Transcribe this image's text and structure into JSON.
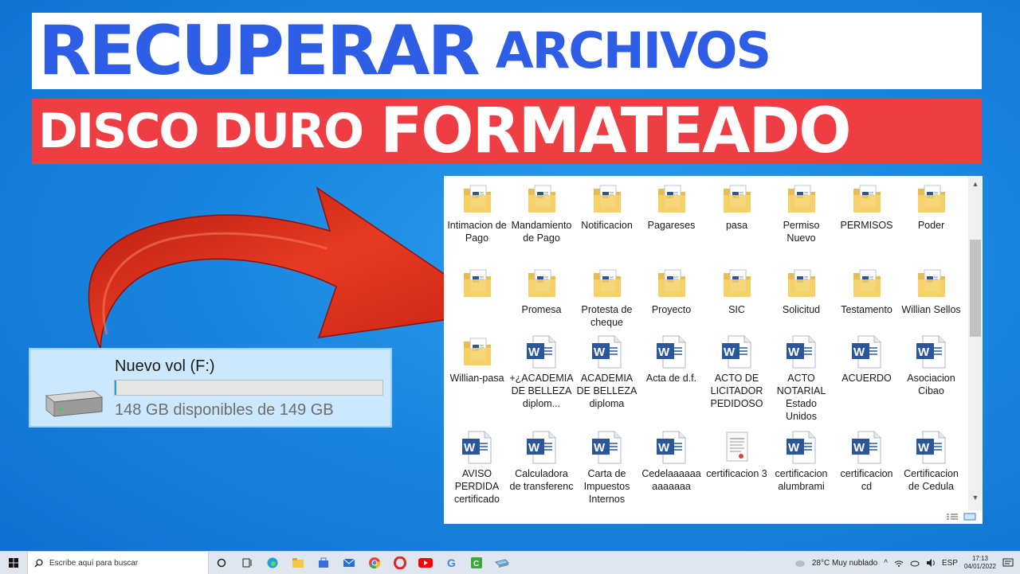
{
  "banner": {
    "line1_big": "RECUPERAR",
    "line1_small": "ARCHIVOS",
    "line2_small": "DISCO DURO",
    "line2_big": "FORMATEADO"
  },
  "drive": {
    "name": "Nuevo vol (F:)",
    "space": "148 GB disponibles de 149 GB",
    "used_fraction": 0.0067,
    "bar_color": "#26a0da"
  },
  "explorer": {
    "items": [
      {
        "label": "Intimacion de Pago",
        "icon": "folder-icon"
      },
      {
        "label": "Mandamiento de Pago",
        "icon": "folder-icon"
      },
      {
        "label": "Notificacion",
        "icon": "folder-icon"
      },
      {
        "label": "Pagareses",
        "icon": "folder-icon"
      },
      {
        "label": "pasa",
        "icon": "folder-icon"
      },
      {
        "label": "Permiso Nuevo",
        "icon": "folder-icon"
      },
      {
        "label": "PERMISOS",
        "icon": "folder-icon"
      },
      {
        "label": "Poder",
        "icon": "folder-icon"
      },
      {
        "label": "",
        "icon": "folder-icon"
      },
      {
        "label": "Promesa",
        "icon": "folder-icon"
      },
      {
        "label": "Protesta de cheque",
        "icon": "folder-icon"
      },
      {
        "label": "Proyecto",
        "icon": "folder-icon"
      },
      {
        "label": "SIC",
        "icon": "folder-icon"
      },
      {
        "label": "Solicitud",
        "icon": "folder-icon"
      },
      {
        "label": "Testamento",
        "icon": "folder-icon"
      },
      {
        "label": "Willian Sellos",
        "icon": "folder-icon"
      },
      {
        "label": "Willian-pasa",
        "icon": "folder-icon"
      },
      {
        "label": "+¿ACADEMIA DE BELLEZA diplom...",
        "icon": "word-doc-icon"
      },
      {
        "label": "ACADEMIA DE BELLEZA diploma",
        "icon": "word-doc-icon"
      },
      {
        "label": "Acta de d.f.",
        "icon": "word-doc-icon"
      },
      {
        "label": "ACTO DE LICITADOR PEDIDOSO",
        "icon": "word-doc-icon"
      },
      {
        "label": "ACTO NOTARIAL Estado Unidos",
        "icon": "word-doc-icon"
      },
      {
        "label": "ACUERDO",
        "icon": "word-doc-icon"
      },
      {
        "label": "Asociacion Cibao",
        "icon": "word-doc-icon"
      },
      {
        "label": "AVISO PERDIDA certificado",
        "icon": "word-doc-icon"
      },
      {
        "label": "Calculadora de transferenc",
        "icon": "word-doc-icon"
      },
      {
        "label": "Carta de Impuestos Internos",
        "icon": "word-doc-icon"
      },
      {
        "label": "Cedelaaaaaaaaaaaaa",
        "icon": "word-doc-icon"
      },
      {
        "label": "certificacion 3",
        "icon": "scanned-doc-icon"
      },
      {
        "label": "certificacion alumbrami",
        "icon": "word-doc-icon"
      },
      {
        "label": "certificacion cd",
        "icon": "word-doc-icon"
      },
      {
        "label": "Certificacion de Cedula",
        "icon": "word-doc-icon"
      }
    ]
  },
  "taskbar": {
    "search_placeholder": "Escribe aquí para buscar",
    "weather": "28°C  Muy nublado",
    "lang": "ESP",
    "time": "17:13",
    "date": "04/01/2022"
  },
  "colors": {
    "title_blue": "#2f5ee6",
    "title_red": "#ef3d44",
    "desktop_blue": "#1a86e0",
    "arrow_red": "#e23222"
  }
}
